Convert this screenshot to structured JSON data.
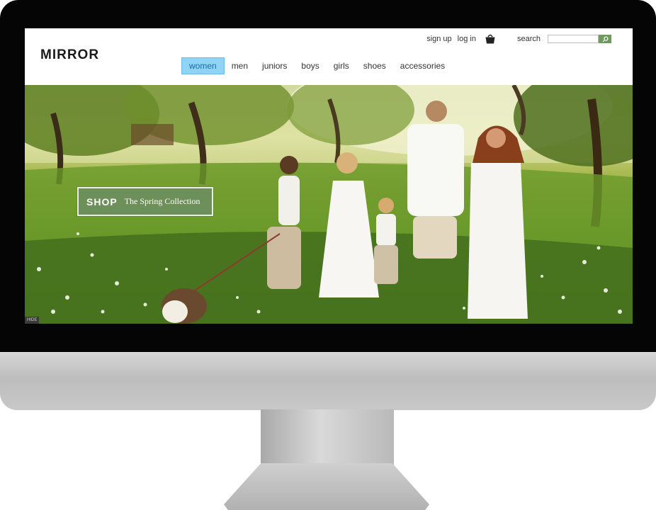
{
  "site": {
    "logo": "MIRROR"
  },
  "top_links": {
    "sign_up": "sign up",
    "log_in": "log in",
    "search_label": "search",
    "search_value": ""
  },
  "nav": {
    "items": [
      "women",
      "men",
      "juniors",
      "boys",
      "girls",
      "shoes",
      "accessories"
    ],
    "active": "women"
  },
  "hero": {
    "cta_shop": "SHOP",
    "cta_text": "The Spring Collection",
    "hide_label": "HIDE"
  },
  "colors": {
    "accent_green": "#6d8f59",
    "active_nav": "#8fd3f5"
  },
  "icons": {
    "basket": "basket-icon",
    "search": "search-icon"
  }
}
